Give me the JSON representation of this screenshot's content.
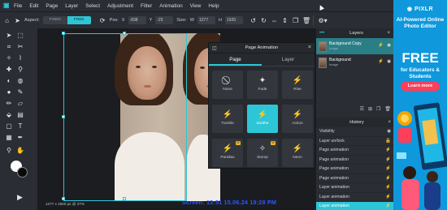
{
  "menubar": {
    "items": [
      "File",
      "Edit",
      "Page",
      "Layer",
      "Select",
      "Adjustment",
      "Filter",
      "Animation",
      "View",
      "Help"
    ]
  },
  "toolbar": {
    "aspect_label": "Aspect:",
    "aspect_options": [
      "FIXED",
      "FREE"
    ],
    "aspect_selected": "FREE",
    "pos_label": "Pos:",
    "pos_x_label": "X",
    "pos_x": "-838",
    "pos_y_label": "Y",
    "pos_y": "-25",
    "size_label": "Size:",
    "size_w_label": "W",
    "size_w": "1277",
    "size_h_label": "H",
    "size_h": "1920"
  },
  "canvas": {
    "status": "1277 x 1920 px @ 27%",
    "watermark": "Screen: 13:51 15.06.24 19:28 PM"
  },
  "animation_panel": {
    "title": "Page Animation",
    "tabs": [
      "Page",
      "Layer"
    ],
    "active_tab": "Page",
    "effects": [
      {
        "label": "None",
        "icon": "none-icon",
        "premium": false,
        "selected": false
      },
      {
        "label": "Fade",
        "icon": "fade-icon",
        "premium": false,
        "selected": false
      },
      {
        "label": "Rise",
        "icon": "rise-icon",
        "premium": false,
        "selected": false
      },
      {
        "label": "Tumble",
        "icon": "tumble-icon",
        "premium": false,
        "selected": false
      },
      {
        "label": "Soothe",
        "icon": "soothe-icon",
        "premium": false,
        "selected": true
      },
      {
        "label": "Action",
        "icon": "action-icon",
        "premium": false,
        "selected": false
      },
      {
        "label": "Parallax",
        "icon": "parallax-icon",
        "premium": true,
        "selected": false
      },
      {
        "label": "Stomp",
        "icon": "stomp-icon",
        "premium": true,
        "selected": false
      },
      {
        "label": "Neon",
        "icon": "neon-icon",
        "premium": false,
        "selected": false
      }
    ],
    "premium_badge": "W"
  },
  "layers": {
    "title": "Layers",
    "items": [
      {
        "name": "Background Copy",
        "type": "Image",
        "selected": true
      },
      {
        "name": "Background",
        "type": "Image",
        "selected": false
      }
    ]
  },
  "history": {
    "title": "History",
    "items": [
      "Visibility",
      "Layer un/lock",
      "Page animation",
      "Page animation",
      "Page animation",
      "Page animation",
      "Layer animation",
      "Layer animation",
      "Layer animation"
    ],
    "current_index": 8
  },
  "ad": {
    "brand": "PIXLR",
    "headline": "AI-Powered Online Photo Editor",
    "big": "FREE",
    "sub": "for Educators & Students",
    "button": "Learn more"
  },
  "colors": {
    "accent": "#2dc6d6",
    "ad_bg": "#0f98dc",
    "ad_button": "#ff3e5a",
    "panel": "#2a2d33",
    "watermark": "#2e57ff"
  }
}
